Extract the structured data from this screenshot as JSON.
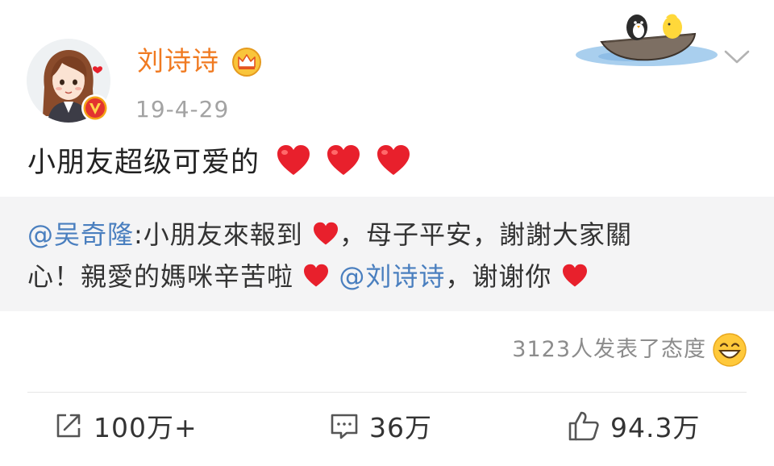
{
  "post": {
    "author": "刘诗诗",
    "timestamp": "19-4-29",
    "text": "小朋友超级可爱的"
  },
  "repost": {
    "mention_author": "@吴奇隆",
    "line1_part1": ":小朋友來報到",
    "line1_part2": "，母子平安，謝謝大家關",
    "line2_part1": "心！親愛的媽咪辛苦啦",
    "line2_mention": "@刘诗诗",
    "line2_part2": "，谢谢你"
  },
  "reactions": {
    "summary": "3123人发表了态度"
  },
  "actions": {
    "repost_count": "100万+",
    "comment_count": "36万",
    "like_count": "94.3万"
  },
  "colors": {
    "username": "#f07a21",
    "mention": "#4a7fbf",
    "heart": "#e8202c",
    "repost_bg": "#f4f4f5"
  },
  "icons": {
    "verified_badge": "v-verified-icon",
    "crown": "crown-icon",
    "menu": "chevron-down-icon",
    "repost": "share-icon",
    "comment": "comment-icon",
    "like": "thumbs-up-icon",
    "reaction": "laughing-emoji-icon"
  }
}
